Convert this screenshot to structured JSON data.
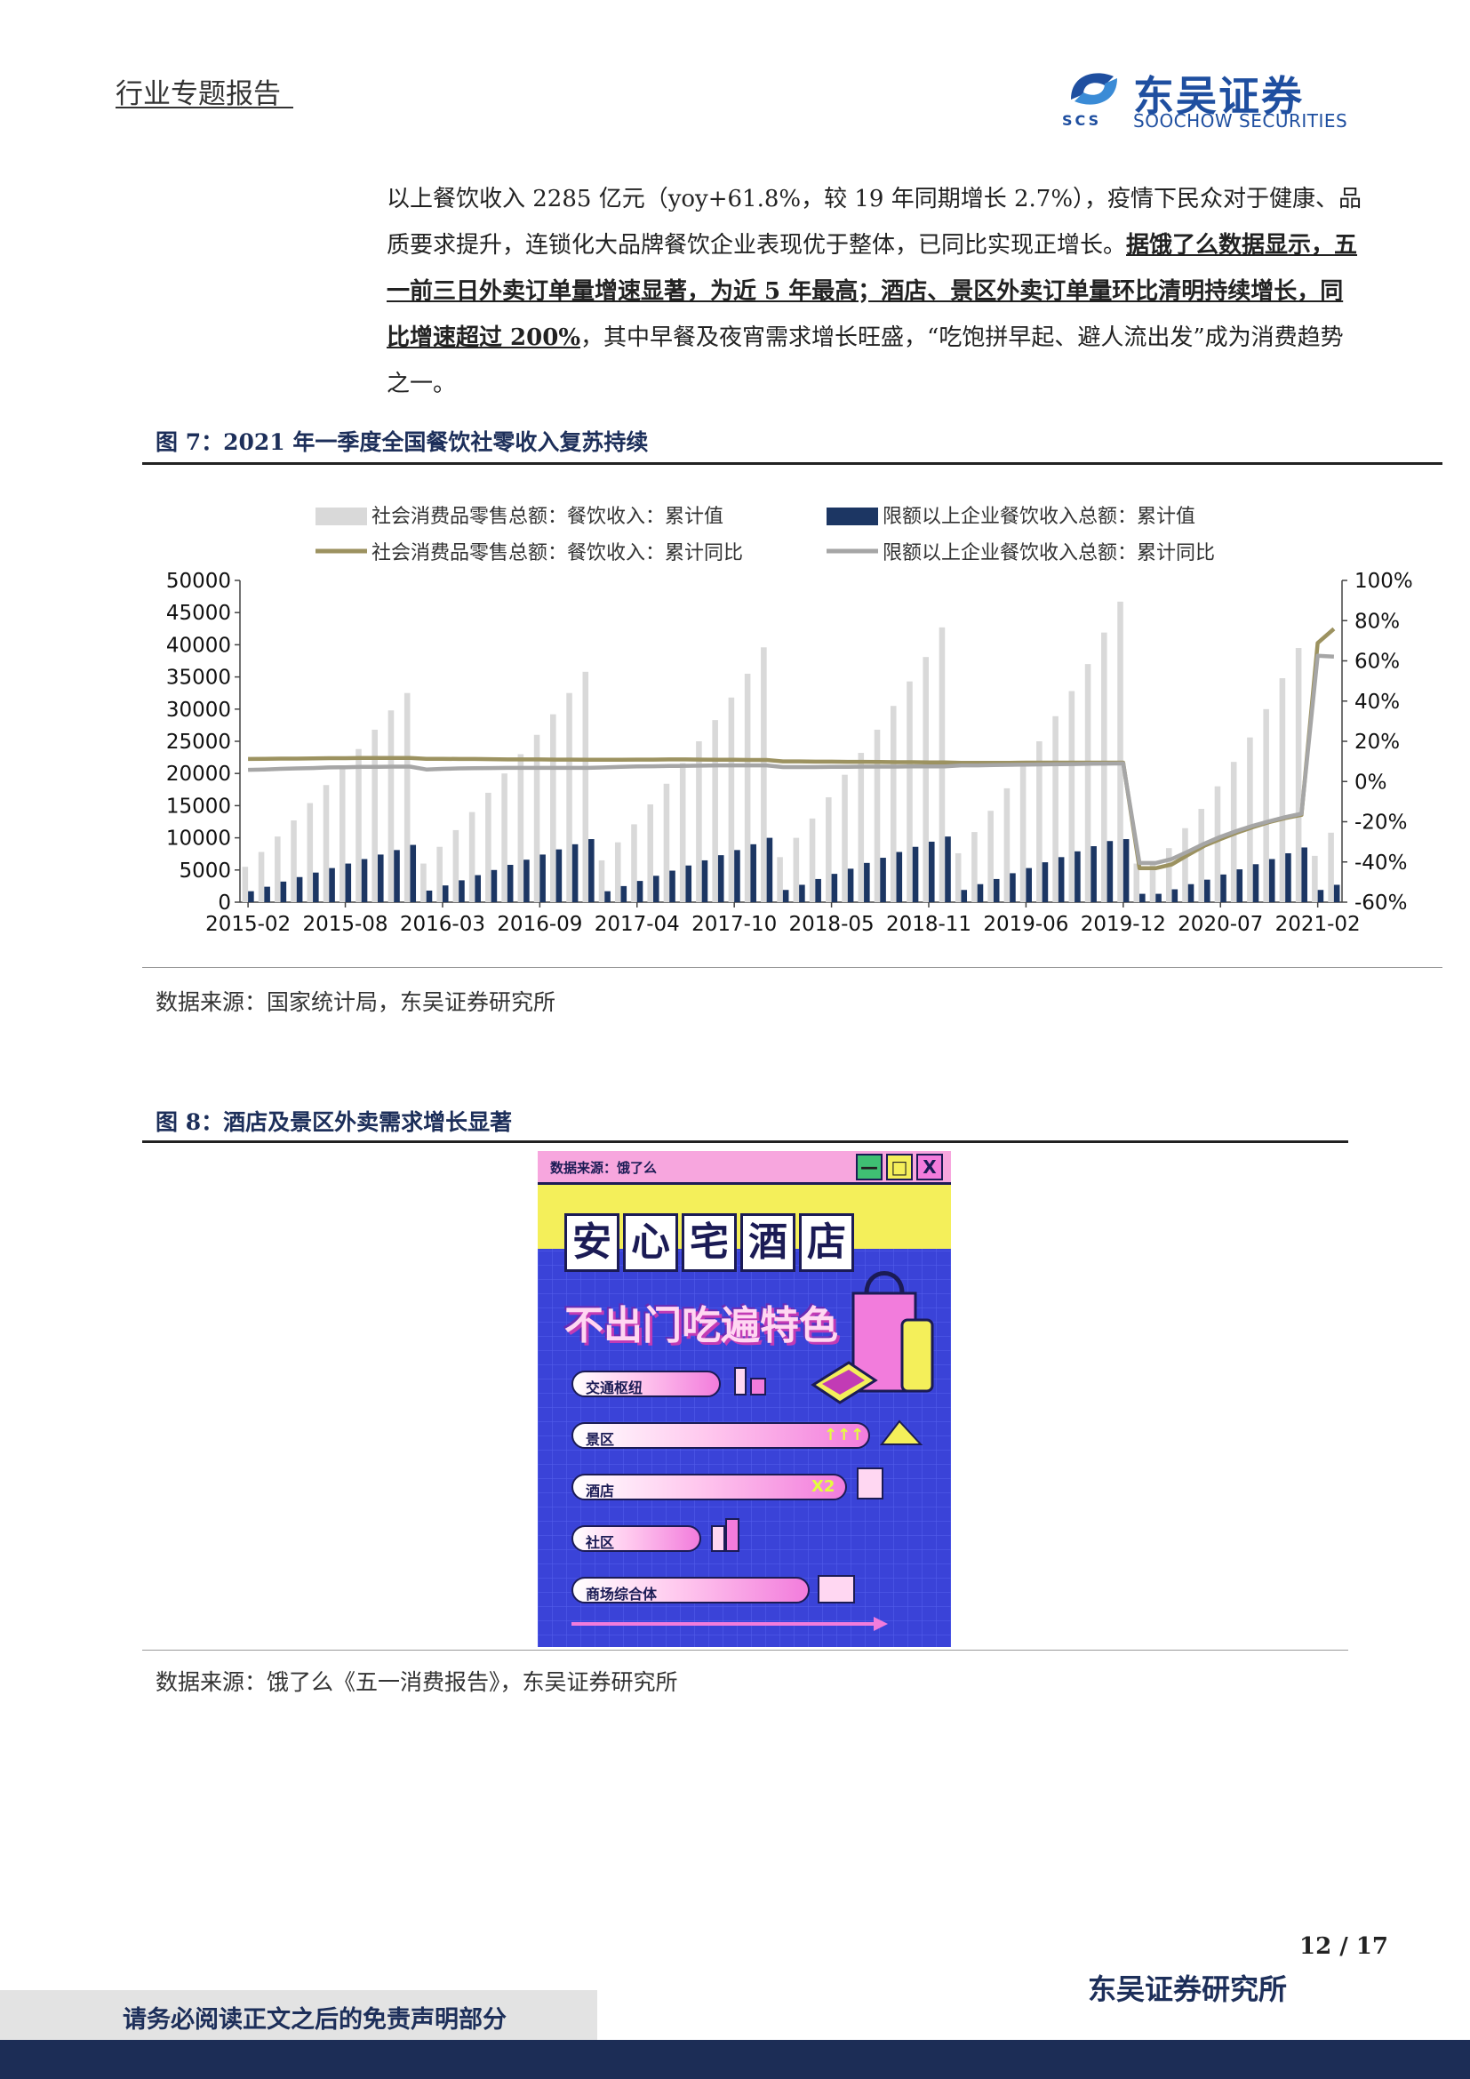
{
  "header": {
    "report_type": "行业专题报告",
    "logo_name": "东吴证券",
    "logo_sub": "SOOCHOW SECURITIES",
    "logo_abbr": "SCS"
  },
  "body": {
    "p1": "以上餐饮收入 2285 亿元（yoy+61.8%，较 19 年同期增长 2.7%），疫情下民众对于健康、品质要求提升，连锁化大品牌餐饮企业表现优于整体，已同比实现正增长。",
    "p2": "据饿了么数据显示，五一前三日外卖订单量增速显著，为近 5 年最高；酒店、景区外卖订单量环比清明持续增长，同比增速超过 200%",
    "p3": "，其中早餐及夜宵需求增长旺盛，“吃饱拼早起、避人流出发”成为消费趋势之一。"
  },
  "figure7": {
    "title": "图 7：2021 年一季度全国餐饮社零收入复苏持续",
    "source": "数据来源：国家统计局，东吴证券研究所"
  },
  "figure8": {
    "title": "图 8：酒店及景区外卖需求增长显著",
    "source": "数据来源：饿了么《五一消费报告》，东吴证券研究所",
    "poster": {
      "source_tag": "数据来源：饿了么",
      "btn_min": "—",
      "btn_max": "□",
      "btn_close": "X",
      "title_chars": [
        "安",
        "心",
        "宅",
        "酒",
        "店"
      ],
      "subtitle": "不出门吃遍特色",
      "bars": [
        {
          "label": "交通枢纽",
          "extra": ""
        },
        {
          "label": "景区",
          "extra": "↑↑↑"
        },
        {
          "label": "酒店",
          "extra": "X2"
        },
        {
          "label": "社区",
          "extra": ""
        },
        {
          "label": "商场综合体",
          "extra": ""
        }
      ]
    }
  },
  "footer": {
    "page": "12 / 17",
    "institute": "东吴证券研究所",
    "disclaimer": "请务必阅读正文之后的免责声明部分"
  },
  "colors": {
    "bar_light": "#d9d9d9",
    "bar_dark": "#1c3663",
    "line_olive": "#9c9260",
    "line_gray": "#a6a6a6"
  },
  "chart_data": {
    "type": "bar",
    "legend": [
      "社会消费品零售总额：餐饮收入：累计值",
      "限额以上企业餐饮收入总额：累计值",
      "社会消费品零售总额：餐饮收入：累计同比",
      "限额以上企业餐饮收入总额：累计同比"
    ],
    "legend_position": "top",
    "x_tick_labels": [
      "2015-02",
      "2015-08",
      "2016-03",
      "2016-09",
      "2017-04",
      "2017-10",
      "2018-05",
      "2018-11",
      "2019-06",
      "2019-12",
      "2020-07",
      "2021-02"
    ],
    "y_left": {
      "min": 0,
      "max": 50000,
      "ticks": [
        "0",
        "5000",
        "10000",
        "15000",
        "20000",
        "25000",
        "30000",
        "35000",
        "40000",
        "45000",
        "50000"
      ]
    },
    "y_right": {
      "min": -60,
      "max": 100,
      "ticks": [
        "-60%",
        "-40%",
        "-20%",
        "0%",
        "20%",
        "40%",
        "60%",
        "80%",
        "100%"
      ]
    },
    "grid": false,
    "series": [
      {
        "name": "社会消费品零售总额：餐饮收入：累计值",
        "kind": "bar",
        "axis": "left",
        "values": [
          5500,
          7800,
          10200,
          12700,
          15400,
          18200,
          21000,
          23800,
          26800,
          29800,
          32500,
          6000,
          8600,
          11200,
          14000,
          17000,
          20000,
          23000,
          26000,
          29200,
          32500,
          35800,
          6500,
          9300,
          12100,
          15200,
          18400,
          21600,
          25000,
          28300,
          31800,
          35500,
          39600,
          7000,
          10000,
          13000,
          16300,
          19800,
          23200,
          26800,
          30500,
          34300,
          38100,
          42700,
          7600,
          10900,
          14200,
          17700,
          21300,
          25000,
          28900,
          32800,
          37000,
          41900,
          46700,
          6000,
          6000,
          8400,
          11500,
          14500,
          18000,
          21800,
          25600,
          30000,
          34800,
          39500,
          7200,
          10800
        ]
      },
      {
        "name": "限额以上企业餐饮收入总额：累计值",
        "kind": "bar",
        "axis": "left",
        "values": [
          1700,
          2400,
          3200,
          3900,
          4600,
          5300,
          6000,
          6700,
          7400,
          8100,
          8900,
          1800,
          2600,
          3400,
          4200,
          5000,
          5800,
          6600,
          7400,
          8200,
          9000,
          9800,
          1700,
          2500,
          3300,
          4100,
          4900,
          5700,
          6500,
          7300,
          8100,
          9000,
          10000,
          1900,
          2700,
          3600,
          4400,
          5200,
          6100,
          6900,
          7800,
          8600,
          9400,
          10200,
          1900,
          2800,
          3600,
          4500,
          5300,
          6200,
          7000,
          7900,
          8700,
          9500,
          9800,
          1300,
          1300,
          2000,
          2800,
          3500,
          4300,
          5100,
          5900,
          6700,
          7600,
          8500,
          1900,
          2700
        ]
      },
      {
        "name": "社会消费品零售总额：餐饮收入：累计同比",
        "kind": "line",
        "axis": "right",
        "values": [
          11.2,
          11.3,
          11.4,
          11.4,
          11.5,
          11.6,
          11.6,
          11.7,
          11.7,
          11.7,
          11.7,
          11.3,
          11.3,
          11.2,
          11.2,
          11.1,
          11.0,
          11.0,
          11.0,
          10.9,
          10.9,
          10.8,
          10.8,
          10.8,
          10.9,
          10.9,
          11.0,
          11.0,
          10.9,
          10.8,
          10.8,
          10.7,
          10.7,
          10.0,
          10.0,
          9.9,
          9.9,
          9.8,
          9.8,
          9.7,
          9.6,
          9.6,
          9.5,
          9.5,
          9.3,
          9.3,
          9.3,
          9.3,
          9.4,
          9.4,
          9.4,
          9.4,
          9.4,
          9.4,
          9.4,
          -43.1,
          -43.1,
          -41.2,
          -36.5,
          -32.0,
          -28.6,
          -25.5,
          -22.7,
          -20.2,
          -18.2,
          -16.6,
          68.9,
          75.9
        ]
      },
      {
        "name": "限额以上企业餐饮收入总额：累计同比",
        "kind": "line",
        "axis": "right",
        "values": [
          5.8,
          6.0,
          6.3,
          6.5,
          6.7,
          7.0,
          7.1,
          7.3,
          7.3,
          7.4,
          7.4,
          6.0,
          6.3,
          6.5,
          6.6,
          6.7,
          6.8,
          6.8,
          6.8,
          6.8,
          6.8,
          6.8,
          7.0,
          7.3,
          7.5,
          7.6,
          7.7,
          7.8,
          7.9,
          8.0,
          8.0,
          8.0,
          8.0,
          7.2,
          7.2,
          7.2,
          7.3,
          7.3,
          7.4,
          7.4,
          7.4,
          7.5,
          7.5,
          7.5,
          8.0,
          8.0,
          8.2,
          8.3,
          8.4,
          8.5,
          8.6,
          8.7,
          8.8,
          8.9,
          9.0,
          -40.5,
          -40.5,
          -38.5,
          -34.8,
          -30.9,
          -27.5,
          -24.6,
          -22.0,
          -19.8,
          -17.7,
          -16.0,
          62.5,
          62.1
        ]
      }
    ]
  }
}
